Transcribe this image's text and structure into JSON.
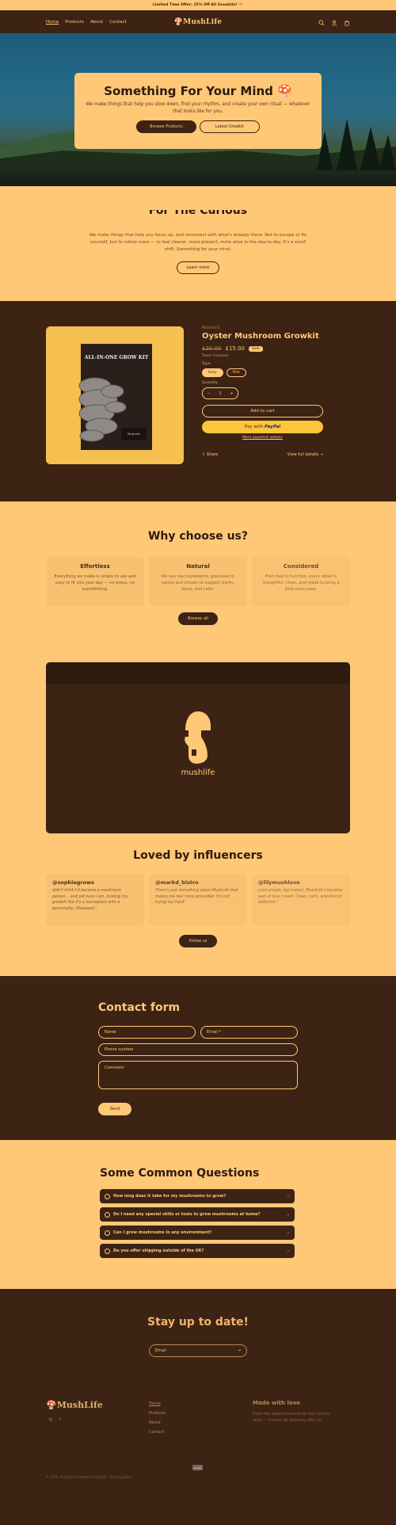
{
  "announcement": "Limited Time Offer: 25% Off All Growkits! 🍄",
  "header": {
    "nav": [
      "Home",
      "Products",
      "About",
      "Contact"
    ],
    "logo": "🍄MushLife"
  },
  "hero": {
    "title": "Something For Your Mind 🍄",
    "subtitle": "We make things that help you slow down, find your rhythm, and create your own ritual — whatever that looks like for you.",
    "btn_primary": "Browse Products",
    "btn_secondary": "Latest Growkit"
  },
  "purpose": {
    "title": "For The Curious",
    "text": "We make things that help you focus up, and reconnect with what's already there. Not to escape or fix yourself, but to notice more — to feel clearer, more present, more alive in the day-to-day. It's a small shift. Something for your mind.",
    "btn": "Learn more"
  },
  "product": {
    "vendor": "MUSHLIFE",
    "title": "Oyster Mushroom Growkit",
    "price_old": "£20.00",
    "price_new": "£15.00",
    "badge": "Sale",
    "tax": "Taxes included.",
    "type_label": "Type",
    "variants": [
      "Grey",
      "Pink"
    ],
    "qty_label": "Quantity",
    "qty": "1",
    "cart_btn": "Add to cart",
    "paypal_pre": "Pay with",
    "paypal": "PayPal",
    "more_pay": "More payment options",
    "share": "Share",
    "view_full": "View full details →",
    "box_title": "ALL-IN-ONE GROW KIT",
    "box_brand": "MushLife"
  },
  "why": {
    "title": "Why choose us?",
    "cols": [
      {
        "title": "Effortless",
        "text": "Everything we make is simple to use and easy to fit into your day — no stress, no overthinking."
      },
      {
        "title": "Natural",
        "text": "We use real ingredients, grounded in nature and chosen to support clarity, focus, and calm."
      },
      {
        "title": "Considered",
        "text": "From feel to function, every detail is thoughtful, clean, and made to bring a little more ease."
      }
    ],
    "btn": "Browse all"
  },
  "video": {
    "brand": "mushlife"
  },
  "influencers": {
    "title": "Loved by influencers",
    "cards": [
      {
        "handle": "@sophiegrows",
        "quote": "didn't think I'd become a mushroom person… and yet here I am, misting my growkit like it's a houseplant with a personality. Obsessed.\""
      },
      {
        "handle": "@markd_bistro",
        "quote": "There's just something about MushLife that makes me feel more grounded. It's not trying too hard\""
      },
      {
        "handle": "@lilymushlove",
        "quote": "Love simple, big impact. MushLife's become part of how I reset. Clean, calm, and kind of addictive.\""
      }
    ],
    "btn": "Follow us"
  },
  "contact": {
    "title": "Contact form",
    "name": "Name",
    "email": "Email *",
    "phone": "Phone number",
    "comment": "Comment",
    "send": "Send"
  },
  "faq": {
    "title": "Some Common Questions",
    "items": [
      "How long does it take for my mushrooms to grow?",
      "Do I need any special skills or tools to grow mushrooms at home?",
      "Can I grow mushrooms in any environment?",
      "Do you offer shipping outside of the UK?"
    ]
  },
  "newsletter": {
    "title": "Stay up to date!",
    "placeholder": "Email"
  },
  "footer": {
    "logo": "🍄MushLife",
    "links": [
      "Home",
      "Products",
      "About",
      "Contact"
    ],
    "made_title": "Made with love",
    "made_text": "From the quiet moments to the curious ones — thanks for growing with us.",
    "copyright": "© 2025, MushLife Powered by Shopify · Privacy policy",
    "pay": "PayPal"
  },
  "colors": {
    "cream": "#ffc877",
    "brown": "#3c2314",
    "paypal": "#ffc439"
  }
}
